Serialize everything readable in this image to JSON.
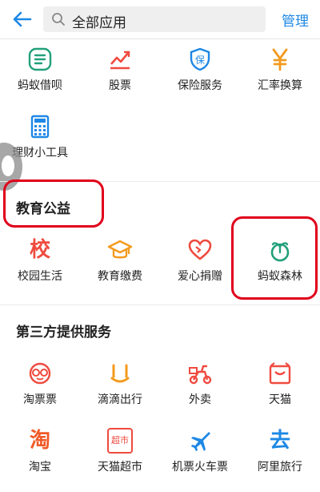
{
  "header": {
    "search_value": "全部应用",
    "manage_label": "管理"
  },
  "rows": {
    "finance_row1": [
      {
        "label": "蚂蚁借呗",
        "icon": "jiebei-icon",
        "color": "#22a07a"
      },
      {
        "label": "股票",
        "icon": "stock-chart-icon",
        "color": "#ef4b3f"
      },
      {
        "label": "保险服务",
        "icon": "insurance-shield-icon",
        "color": "#1e88e5"
      },
      {
        "label": "汇率换算",
        "icon": "yen-icon",
        "color": "#f39a1e"
      }
    ],
    "finance_row2": [
      {
        "label": "理财小工具",
        "icon": "calculator-icon",
        "color": "#1e88e5"
      }
    ]
  },
  "sections": {
    "education": {
      "title": "教育公益",
      "items": [
        {
          "label": "校园生活",
          "icon": "school-char-icon",
          "color": "#ef4b3f",
          "glyph": "校"
        },
        {
          "label": "教育缴费",
          "icon": "graduation-cap-icon",
          "color": "#f39a1e"
        },
        {
          "label": "爱心捐赠",
          "icon": "heart-icon",
          "color": "#ef4b3f"
        },
        {
          "label": "蚂蚁森林",
          "icon": "ant-forest-sprout-icon",
          "color": "#22a07a"
        }
      ]
    },
    "third_party": {
      "title": "第三方提供服务",
      "items": [
        {
          "label": "淘票票",
          "icon": "taopiaopiao-glasses-icon",
          "color": "#ef4b3f"
        },
        {
          "label": "滴滴出行",
          "icon": "didi-icon",
          "color": "#f39a1e"
        },
        {
          "label": "外卖",
          "icon": "scooter-icon",
          "color": "#ef4b3f"
        },
        {
          "label": "天猫",
          "icon": "tmall-bag-icon",
          "color": "#ef4b3f"
        },
        {
          "label": "淘宝",
          "icon": "taobao-char-icon",
          "color": "#f05a28",
          "glyph": "淘"
        },
        {
          "label": "天猫超市",
          "icon": "tmall-supermarket-icon",
          "color": "#ef4b3f",
          "glyph": "超市"
        },
        {
          "label": "机票火车票",
          "icon": "airplane-icon",
          "color": "#1e88e5"
        },
        {
          "label": "阿里旅行",
          "icon": "alitrip-char-icon",
          "color": "#1e88e5",
          "glyph": "去"
        }
      ]
    }
  },
  "colors": {
    "accent": "#1e88e5",
    "highlight_ring": "#e0001b"
  }
}
